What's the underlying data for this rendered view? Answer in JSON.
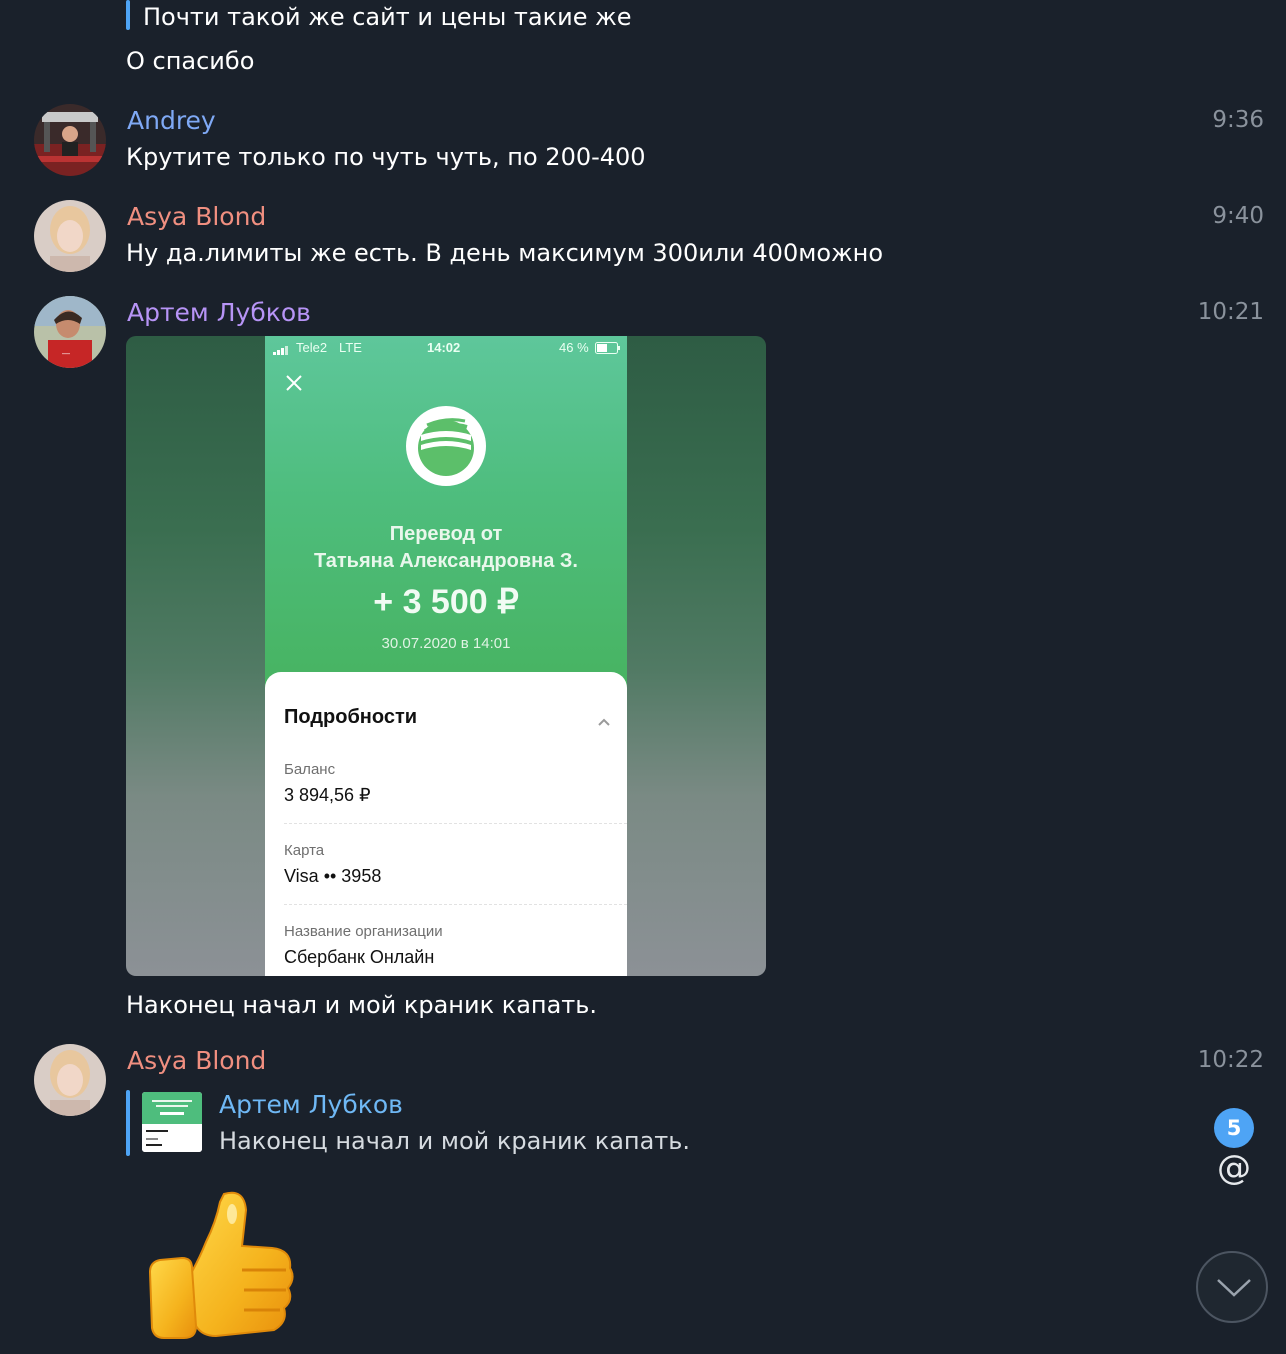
{
  "colors": {
    "background": "#1a212b",
    "accent": "#4ea4f5",
    "name_andrey": "#7fa9f5",
    "name_asya": "#f08f80",
    "name_artem": "#b794f6",
    "name_reply": "#6fb8f5"
  },
  "messages": [
    {
      "quote_text": "Почти такой же сайт и цены такие же",
      "text": "О спасибо"
    },
    {
      "sender": "Andrey",
      "time": "9:36",
      "text": "Крутите только по чуть чуть, по 200-400"
    },
    {
      "sender": "Asya Blond",
      "time": "9:40",
      "text": "Ну да.лимиты же есть. В день максимум 300или 400можно"
    },
    {
      "sender": "Артем Лубков",
      "time": "10:21",
      "caption": "Наконец начал и мой краник капать."
    },
    {
      "sender": "Asya Blond",
      "time": "10:22",
      "reply": {
        "author": "Артем Лубков",
        "text": "Наконец начал и мой краник капать."
      },
      "sticker": "thumbs-up"
    }
  ],
  "photo": {
    "carrier": "Tele2",
    "network": "LTE",
    "clock": "14:02",
    "battery": "46 %",
    "title_line1": "Перевод от",
    "title_line2": "Татьяна Александровна З.",
    "amount": "+ 3 500 ₽",
    "date": "30.07.2020 в 14:01",
    "details_title": "Подробности",
    "rows": [
      {
        "label": "Баланс",
        "value": "3 894,56 ₽"
      },
      {
        "label": "Карта",
        "value": "Visa •• 3958"
      },
      {
        "label": "Название организации",
        "value": "Сбербанк Онлайн"
      }
    ]
  },
  "mentions_badge": "5",
  "mention_icon": "@"
}
